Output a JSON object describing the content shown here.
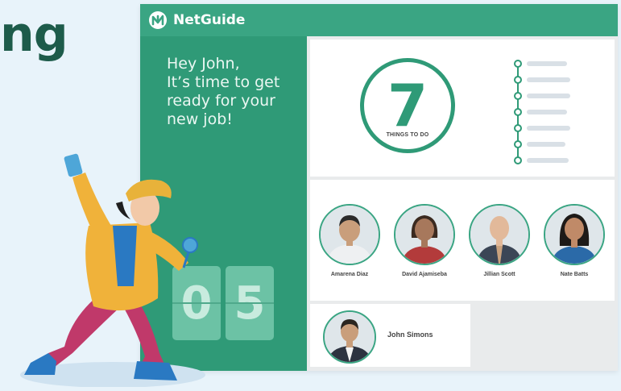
{
  "headline": "ng",
  "app": {
    "brand": "NetGuide",
    "greeting_lines": [
      "Hey John,",
      "It’s time to get",
      "ready for your",
      "new job!"
    ],
    "countdown_digits": [
      "0",
      "5"
    ],
    "todo": {
      "count": "7",
      "label": "THINGS TO DO",
      "items": 7
    },
    "team": [
      {
        "name": "Amarena Diaz",
        "shirt": "#eef0f2",
        "skin": "#c99e7b",
        "hair": "#2b2b2b"
      },
      {
        "name": "David Ajamiseba",
        "shirt": "#b33b3b",
        "skin": "#a7785c",
        "hair": "#3b2a20"
      },
      {
        "name": "Jillian Scott",
        "shirt": "#3b4656",
        "skin": "#e2b99a",
        "hair": "#c9a27e"
      },
      {
        "name": "Nate Batts",
        "shirt": "#2b6aa8",
        "skin": "#c08a68",
        "hair": "#1e1a18"
      }
    ],
    "manager": {
      "name": "John Simons"
    }
  },
  "colors": {
    "brand_green": "#3aa583",
    "panel_green": "#2f9a77",
    "headline": "#1d5b4a"
  }
}
